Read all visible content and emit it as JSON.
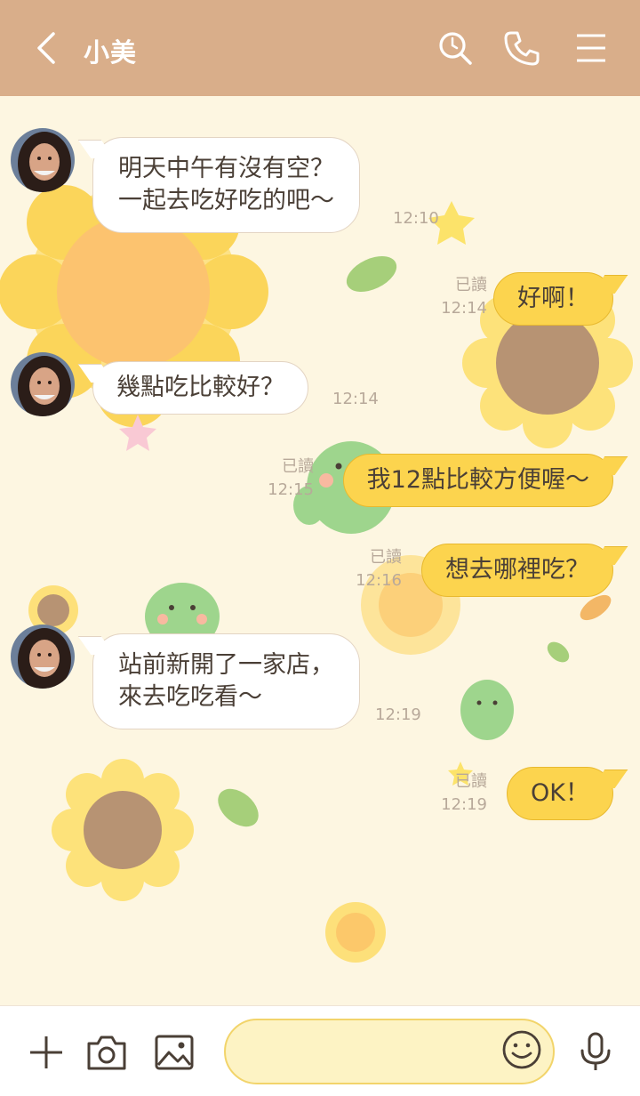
{
  "header": {
    "title": "小美",
    "back_icon": "chevron-left-icon",
    "search_icon": "search-icon",
    "call_icon": "phone-icon",
    "menu_icon": "menu-icon",
    "background": "#d9ae8a"
  },
  "messages": [
    {
      "direction": "in",
      "text_lines": [
        "明天中午有沒有空？",
        "一起去吃好吃的吧～"
      ],
      "time": "12:10"
    },
    {
      "direction": "out",
      "text": "好啊！",
      "read": "已讀",
      "time": "12:14"
    },
    {
      "direction": "in",
      "text": "幾點吃比較好？",
      "time": "12:14"
    },
    {
      "direction": "out",
      "text": "我12點比較方便喔～",
      "read": "已讀",
      "time": "12:15"
    },
    {
      "direction": "out",
      "text": "想去哪裡吃？",
      "read": "已讀",
      "time": "12:16"
    },
    {
      "direction": "in",
      "text_lines": [
        "站前新開了一家店，",
        "來去吃吃看～"
      ],
      "time": "12:19"
    },
    {
      "direction": "out",
      "text": "OK！",
      "read": "已讀",
      "time": "12:19"
    }
  ],
  "footer": {
    "add_icon": "plus-icon",
    "camera_icon": "camera-icon",
    "image_icon": "image-icon",
    "input_value": "",
    "emoji_icon": "smile-icon",
    "mic_icon": "microphone-icon"
  },
  "colors": {
    "chat_background": "#fdf6e1",
    "outgoing_bubble": "#fcd44e",
    "incoming_bubble": "#ffffff",
    "input_background": "#fdf3c4"
  }
}
